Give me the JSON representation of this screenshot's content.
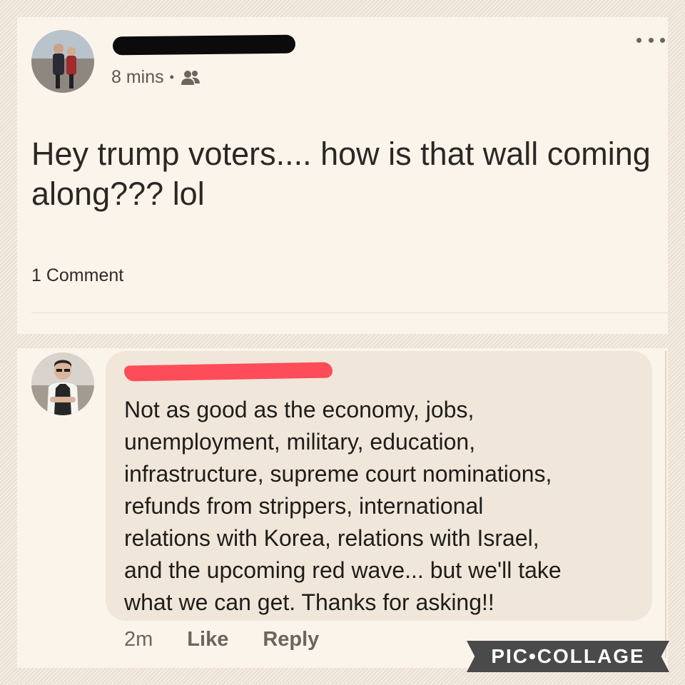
{
  "post": {
    "author_name": "",
    "timestamp": "8 mins",
    "separator": "•",
    "audience_icon": "friends-icon",
    "menu_icon": "more-horizontal-icon",
    "text": "Hey trump voters.... how is that wall coming along??? lol",
    "comments_count": "1 Comment"
  },
  "comment": {
    "author_name": "",
    "text": "Not as good as the economy, jobs,\nunemployment, military, education,\ninfrastructure, supreme court nominations,\nrefunds from strippers, international\nrelations with Korea, relations with Israel,\nand the upcoming red wave... but we'll take\nwhat we can get. Thanks for asking!!",
    "timestamp": "2m",
    "like_label": "Like",
    "reply_label": "Reply"
  },
  "watermark": {
    "text": "PIC•COLLAGE"
  },
  "colors": {
    "background": "#efe4d6",
    "panel": "#fbf4ea",
    "bubble": "#f0e7da",
    "post_redaction": "#0b0b0b",
    "comment_redaction": "#ff3f4f"
  }
}
